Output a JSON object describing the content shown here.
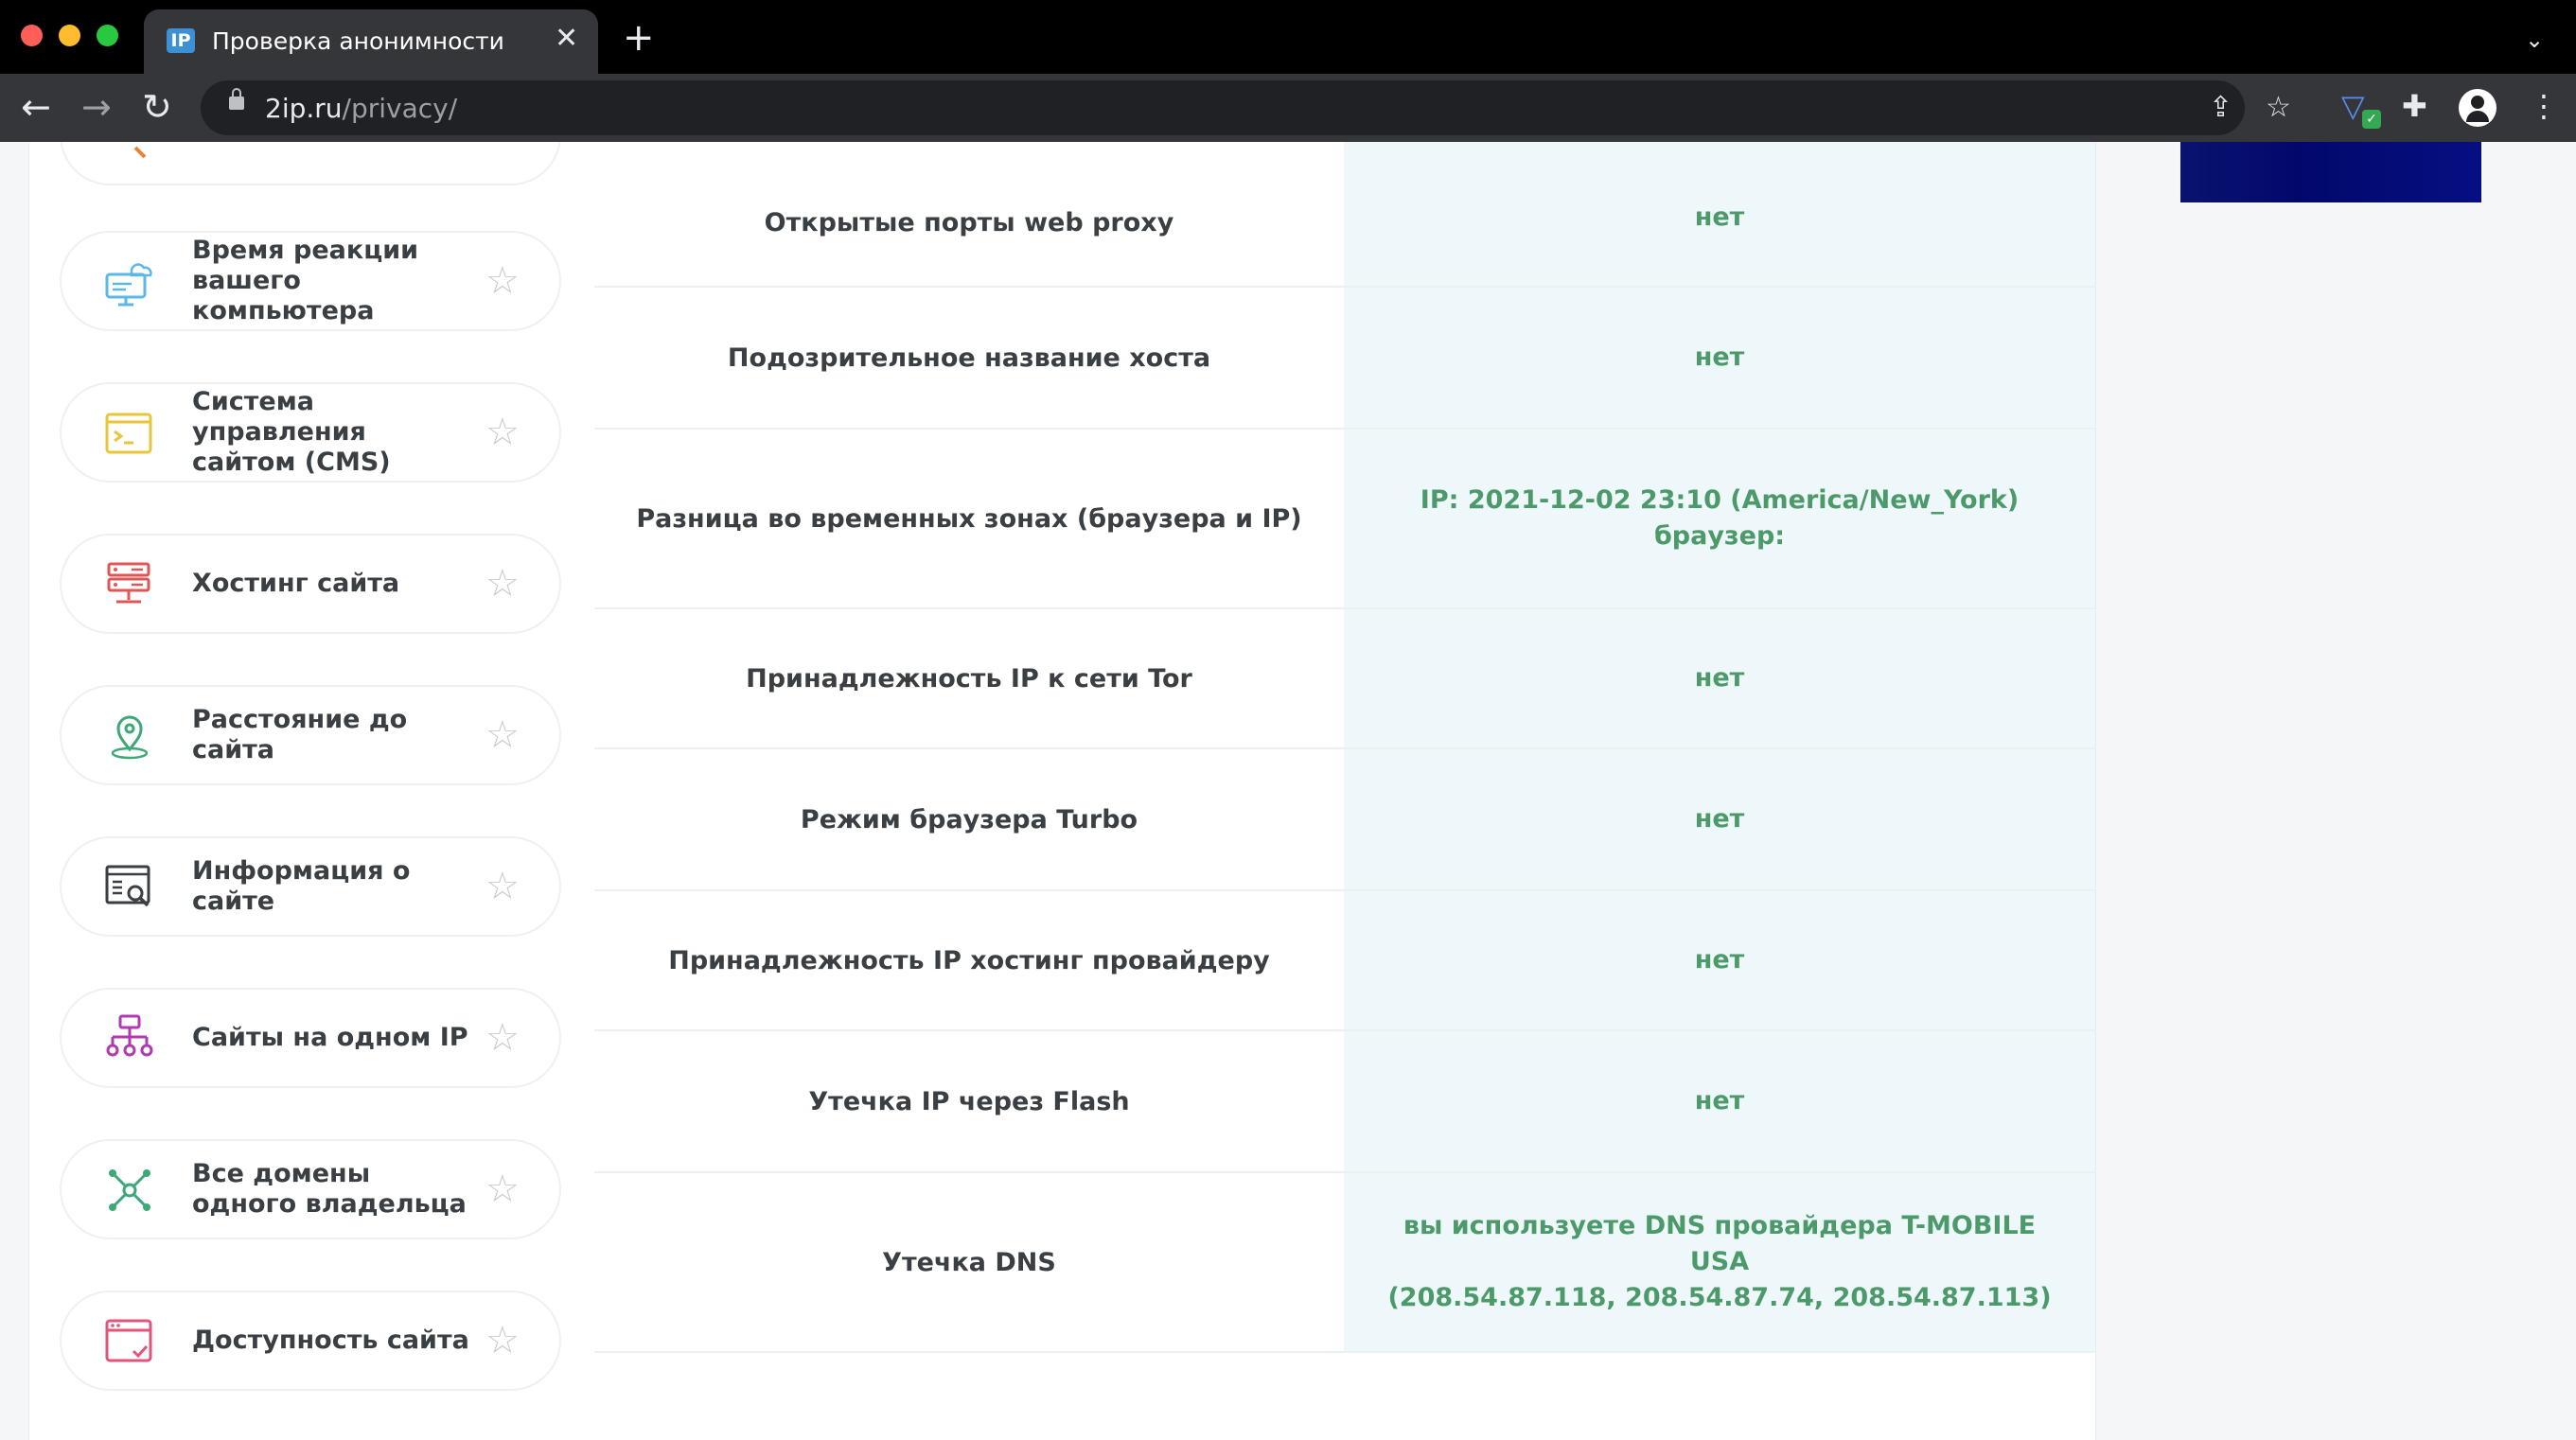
{
  "browser": {
    "tab_title": "Проверка анонимности",
    "tab_favicon_text": "IP",
    "url_host": "2ip.ru",
    "url_path": "/privacy/"
  },
  "sidebar": {
    "items": [
      {
        "label": "Время реакции вашего компьютера",
        "icon": "monitor-cloud-icon",
        "color": "#5bb7e6"
      },
      {
        "label": "Система управления сайтом (CMS)",
        "icon": "terminal-window-icon",
        "color": "#e8c53a"
      },
      {
        "label": "Хостинг сайта",
        "icon": "server-icon",
        "color": "#e05555"
      },
      {
        "label": "Расстояние до сайта",
        "icon": "map-pin-icon",
        "color": "#3fa877"
      },
      {
        "label": "Информация о сайте",
        "icon": "site-search-icon",
        "color": "#3a3f44"
      },
      {
        "label": "Сайты на одном IP",
        "icon": "network-tree-icon",
        "color": "#b03ab0"
      },
      {
        "label": "Все домены одного владельца",
        "icon": "hub-nodes-icon",
        "color": "#3fa877"
      },
      {
        "label": "Доступность сайта",
        "icon": "browser-check-icon",
        "color": "#e0557a"
      }
    ]
  },
  "table": {
    "rows": [
      {
        "label": "Открытые порты web proxy",
        "value": "нет"
      },
      {
        "label": "Подозрительное название хоста",
        "value": "нет"
      },
      {
        "label": "Разница во временных зонах (браузера и IP)",
        "value": "IP: 2021-12-02 23:10 (America/New_York)\nбраузер:"
      },
      {
        "label": "Принадлежность IP к сети Tor",
        "value": "нет"
      },
      {
        "label": "Режим браузера Turbo",
        "value": "нет"
      },
      {
        "label": "Принадлежность IP хостинг провайдеру",
        "value": "нет"
      },
      {
        "label": "Утечка IP через Flash",
        "value": "нет"
      },
      {
        "label": "Утечка DNS",
        "value": "вы используете DNS провайдера T-MOBILE USA\n(208.54.87.118, 208.54.87.74, 208.54.87.113)"
      }
    ]
  },
  "colors": {
    "value_text": "#4c9a6a",
    "value_bg": "#eef7fa",
    "ad": "#0a1370"
  }
}
